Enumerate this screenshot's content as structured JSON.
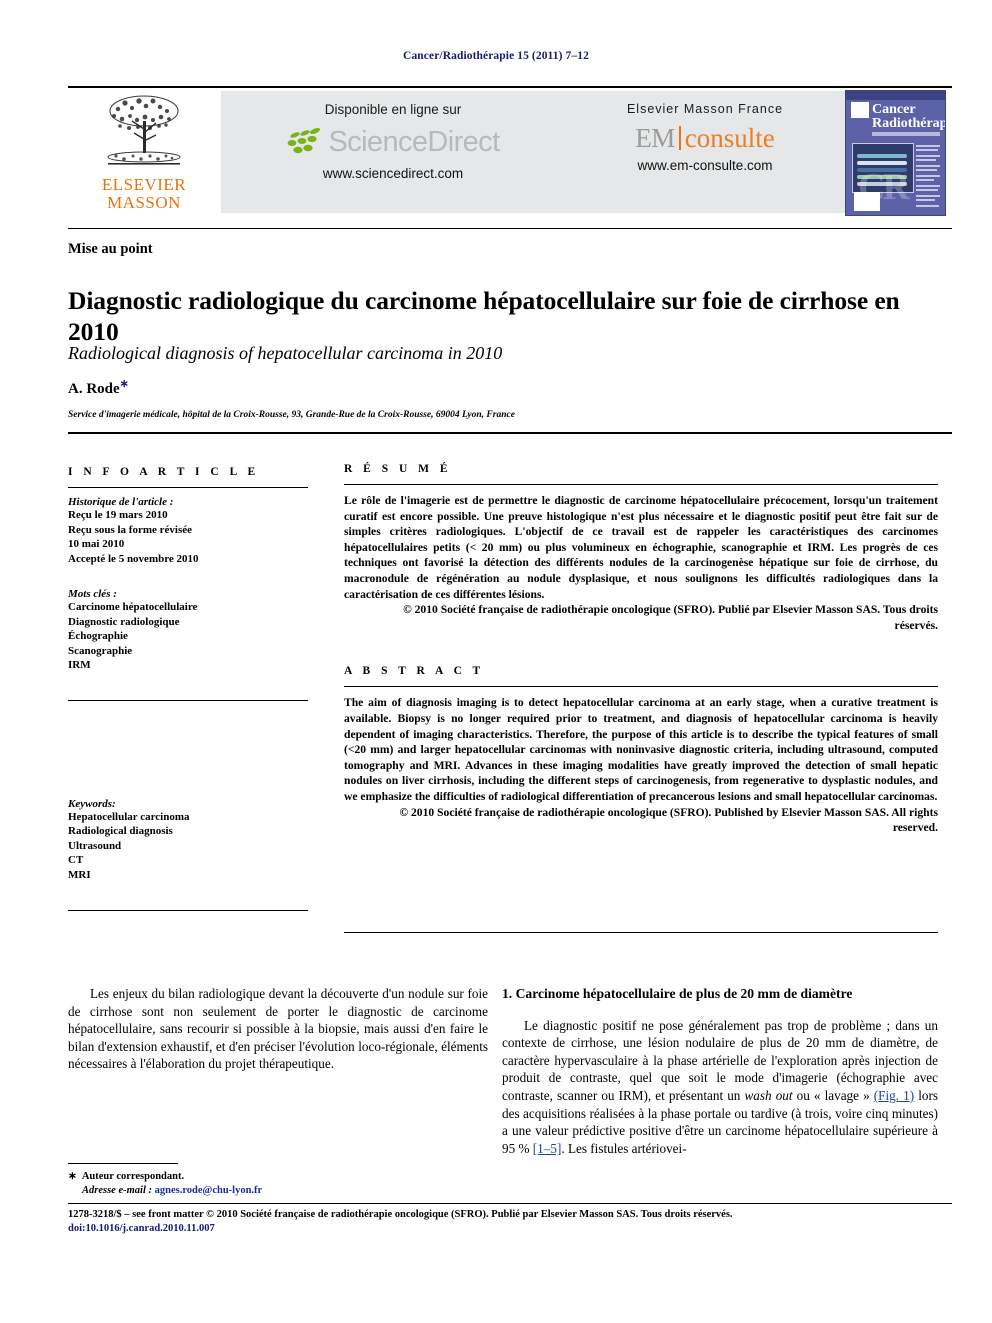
{
  "running_head": "Cancer/Radiothérapie 15 (2011) 7–12",
  "banner": {
    "elsevier_logo": {
      "line1": "ELSEVIER",
      "line2": "MASSON",
      "icon": "elsevier-tree-logo"
    },
    "sciencedirect": {
      "caption": "Disponible en ligne sur",
      "wordmark": "ScienceDirect",
      "url": "www.sciencedirect.com",
      "leaf_color": "#7ab317",
      "word_color": "#b7b9ba"
    },
    "emconsulte": {
      "caption": "Elsevier Masson France",
      "mark_left": "EM",
      "mark_right": "consulte",
      "url": "www.em-consulte.com",
      "accent_color": "#ef7e22"
    },
    "cover": {
      "title_line1": "Cancer",
      "title_line2": "Radiothérapie",
      "monogram": "CR",
      "background_color": "#5b62a8"
    }
  },
  "article": {
    "section_type": "Mise au point",
    "title": "Diagnostic radiologique du carcinome hépatocellulaire sur foie de cirrhose en 2010",
    "subtitle": "Radiological diagnosis of hepatocellular carcinoma in 2010",
    "author": "A. Rode",
    "author_marker": "∗",
    "affiliation": "Service d'imagerie médicale, hôpital de la Croix-Rousse, 93, Grande-Rue de la Croix-Rousse, 69004 Lyon, France"
  },
  "info": {
    "label": "I N F O   A R T I C L E",
    "history_label": "Historique de l'article :",
    "history": [
      "Reçu le 19 mars 2010",
      "Reçu sous la forme révisée",
      "10 mai 2010",
      "Accepté le 5 novembre 2010"
    ],
    "keywords_fr_label": "Mots clés :",
    "keywords_fr": [
      "Carcinome hépatocellulaire",
      "Diagnostic radiologique",
      "Échographie",
      "Scanographie",
      "IRM"
    ],
    "keywords_en_label": "Keywords:",
    "keywords_en": [
      "Hepatocellular carcinoma",
      "Radiological diagnosis",
      "Ultrasound",
      "CT",
      "MRI"
    ]
  },
  "resume": {
    "label": "R É S U M É",
    "text": "Le rôle de l'imagerie est de permettre le diagnostic de carcinome hépatocellulaire précocement, lorsqu'un traitement curatif est encore possible. Une preuve histologique n'est plus nécessaire et le diagnostic positif peut être fait sur de simples critères radiologiques. L'objectif de ce travail est de rappeler les caractéristiques des carcinomes hépatocellulaires petits (< 20 mm) ou plus volumineux en échographie, scanographie et IRM. Les progrès de ces techniques ont favorisé la détection des différents nodules de la carcinogenèse hépatique sur foie de cirrhose, du macronodule de régénération au nodule dysplasique, et nous soulignons les difficultés radiologiques dans la caractérisation de ces différentes lésions.",
    "copyright": "© 2010 Société française de radiothérapie oncologique (SFRO). Publié par Elsevier Masson SAS. Tous droits réservés."
  },
  "abstract": {
    "label": "A B S T R A C T",
    "text": "The aim of diagnosis imaging is to detect hepatocellular carcinoma at an early stage, when a curative treatment is available. Biopsy is no longer required prior to treatment, and diagnosis of hepatocellular carcinoma is heavily dependent of imaging characteristics. Therefore, the purpose of this article is to describe the typical features of small (<20 mm) and larger hepatocellular carcinomas with noninvasive diagnostic criteria, including ultrasound, computed tomography and MRI. Advances in these imaging modalities have greatly improved the detection of small hepatic nodules on liver cirrhosis, including the different steps of carcinogenesis, from regenerative to dysplastic nodules, and we emphasize the difficulties of radiological differentiation of precancerous lesions and small hepatocellular carcinomas.",
    "copyright": "© 2010 Société française de radiothérapie oncologique (SFRO). Published by Elsevier Masson SAS. All rights reserved."
  },
  "body": {
    "intro_paragraph": "Les enjeux du bilan radiologique devant la découverte d'un nodule sur foie de cirrhose sont non seulement de porter le diagnostic de carcinome hépatocellulaire, sans recourir si possible à la biopsie, mais aussi d'en faire le bilan d'extension exhaustif, et d'en préciser l'évolution loco-régionale, éléments nécessaires à l'élaboration du projet thérapeutique.",
    "section1_heading": "1. Carcinome hépatocellulaire de plus de 20 mm de diamètre",
    "section1_part1": "Le diagnostic positif ne pose généralement pas trop de problème ; dans un contexte de cirrhose, une lésion nodulaire de plus de 20 mm de diamètre, de caractère hypervasculaire à la phase artérielle de l'exploration après injection de produit de contraste, quel que soit le mode d'imagerie (échographie avec contraste, scanner ou IRM), et présentant un ",
    "section1_italic": "wash out",
    "section1_part2": " ou « lavage » ",
    "section1_figref": "(Fig. 1)",
    "section1_part3": " lors des acquisitions réalisées à la phase portale ou tardive (à trois, voire cinq minutes) a une valeur prédictive positive d'être un carcinome hépatocellulaire supérieure à 95 % ",
    "section1_citation": "[1–5]",
    "section1_part4": ". Les fistules artériovei-"
  },
  "footnote": {
    "marker": "∗",
    "corresponding": "Auteur correspondant.",
    "email_label": "Adresse e-mail :",
    "email": "agnes.rode@chu-lyon.fr"
  },
  "footer": {
    "line1": "1278-3218/$ – see front matter © 2010 Société française de radiothérapie oncologique (SFRO). Publié par Elsevier Masson SAS. Tous droits réservés.",
    "doi": "doi:10.1016/j.canrad.2010.11.007"
  }
}
